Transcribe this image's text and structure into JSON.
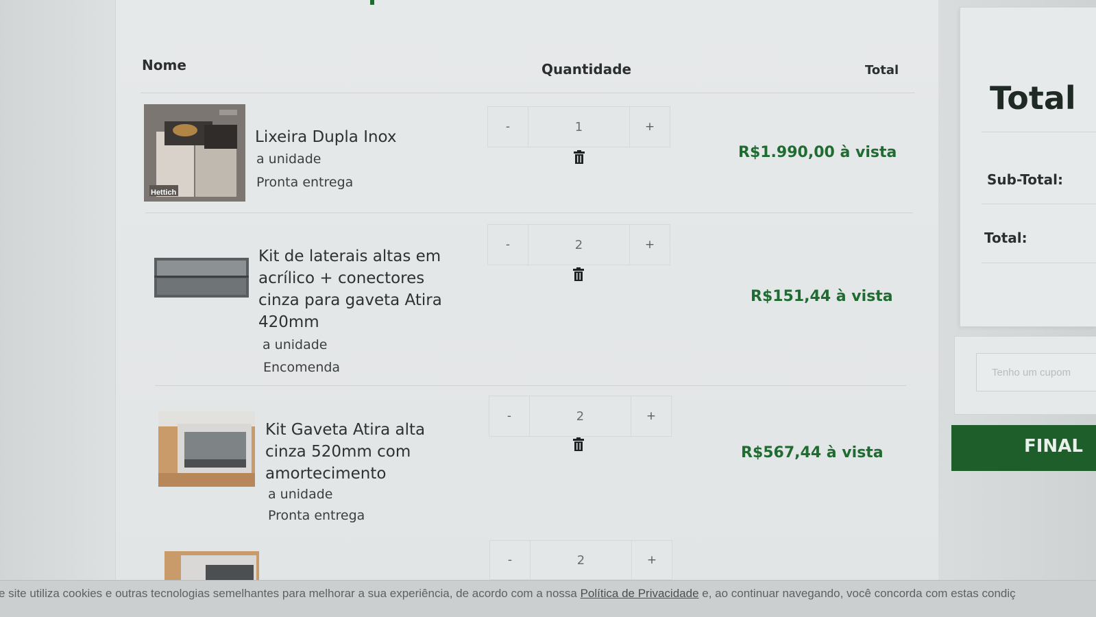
{
  "table": {
    "headers": {
      "name": "Nome",
      "quantity": "Quantidade",
      "total": "Total"
    }
  },
  "items": [
    {
      "name": "Lixeira Dupla Inox",
      "unit": "a unidade",
      "status": "Pronta entrega",
      "quantity": "1",
      "minus": "-",
      "plus": "+",
      "price": "R$1.990,00 à vista",
      "thumb_brand": "Hettich"
    },
    {
      "name": "Kit de laterais altas em acrílico + conectores cinza para gaveta Atira 420mm",
      "unit": "a unidade",
      "status": "Encomenda",
      "quantity": "2",
      "minus": "-",
      "plus": "+",
      "price": "R$151,44 à vista"
    },
    {
      "name": "Kit Gaveta Atira alta cinza 520mm com amortecimento",
      "unit": "a unidade",
      "status": "Pronta entrega",
      "quantity": "2",
      "minus": "-",
      "plus": "+",
      "price": "R$567,44 à vista"
    },
    {
      "quantity": "2",
      "minus": "-",
      "plus": "+"
    }
  ],
  "summary": {
    "title": "Total",
    "subtotal_label": "Sub-Total:",
    "total_label": "Total:",
    "coupon_placeholder": "Tenho um cupom",
    "finalize_label": "FINAL"
  },
  "cookie": {
    "text_before": "e site utiliza cookies e outras tecnologias semelhantes para melhorar a sua experiência, de acordo com a nossa ",
    "link": "Política de Privacidade",
    "text_after": " e, ao continuar navegando, você concorda com estas condiç"
  },
  "colors": {
    "accent": "#1d5e2a",
    "price": "#1f6b31"
  }
}
